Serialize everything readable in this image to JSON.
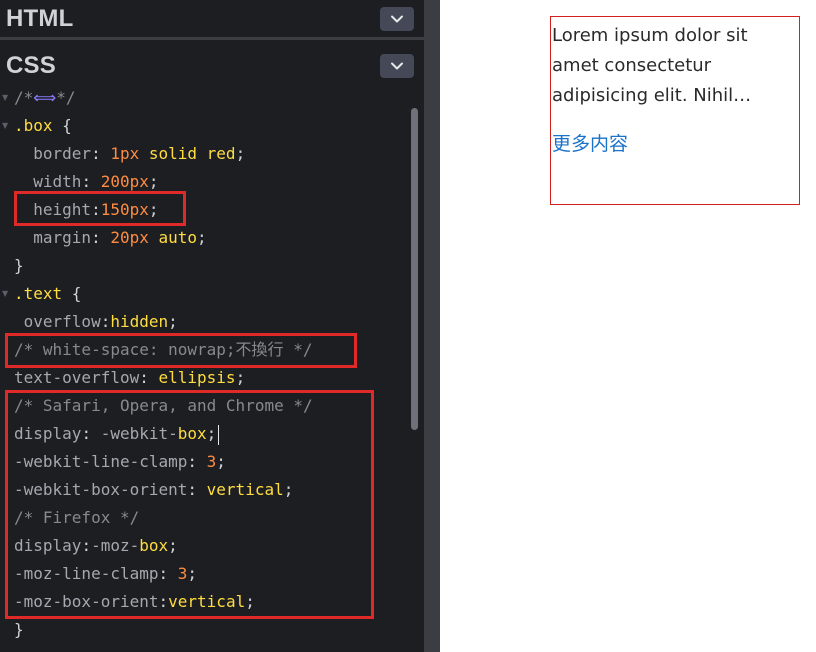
{
  "editor": {
    "html_panel": {
      "title": "HTML",
      "collapse_icon": "chevron-down-icon"
    },
    "css_panel": {
      "title": "CSS",
      "collapse_icon": "chevron-down-icon"
    },
    "code_lines": [
      {
        "tokens": [
          {
            "t": "/*",
            "c": "tok-comment"
          },
          {
            "t": "⟺",
            "c": "tok-arrow"
          },
          {
            "t": "*/",
            "c": "tok-comment"
          }
        ]
      },
      {
        "tokens": [
          {
            "t": ".box",
            "c": "tok-selector"
          },
          {
            "t": " {",
            "c": "tok-punct"
          }
        ]
      },
      {
        "tokens": [
          {
            "t": "  border",
            "c": "tok-prop2"
          },
          {
            "t": ": ",
            "c": "tok-punct"
          },
          {
            "t": "1px",
            "c": "tok-num"
          },
          {
            "t": " solid red",
            "c": "tok-kw"
          },
          {
            "t": ";",
            "c": "tok-punct"
          }
        ]
      },
      {
        "tokens": [
          {
            "t": "  width",
            "c": "tok-prop2"
          },
          {
            "t": ": ",
            "c": "tok-punct"
          },
          {
            "t": "200px",
            "c": "tok-num"
          },
          {
            "t": ";",
            "c": "tok-punct"
          }
        ]
      },
      {
        "tokens": [
          {
            "t": "  height",
            "c": "tok-prop2"
          },
          {
            "t": ":",
            "c": "tok-punct"
          },
          {
            "t": "150px",
            "c": "tok-num"
          },
          {
            "t": ";",
            "c": "tok-punct"
          }
        ]
      },
      {
        "tokens": [
          {
            "t": "  margin",
            "c": "tok-prop2"
          },
          {
            "t": ": ",
            "c": "tok-punct"
          },
          {
            "t": "20px",
            "c": "tok-num"
          },
          {
            "t": " auto",
            "c": "tok-kw"
          },
          {
            "t": ";",
            "c": "tok-punct"
          }
        ]
      },
      {
        "tokens": [
          {
            "t": "}",
            "c": "tok-punct"
          }
        ]
      },
      {
        "tokens": [
          {
            "t": ".text",
            "c": "tok-selector"
          },
          {
            "t": " {",
            "c": "tok-punct"
          }
        ]
      },
      {
        "tokens": [
          {
            "t": " overflow",
            "c": "tok-prop2"
          },
          {
            "t": ":",
            "c": "tok-punct"
          },
          {
            "t": "hidden",
            "c": "tok-kw"
          },
          {
            "t": ";",
            "c": "tok-punct"
          }
        ]
      },
      {
        "tokens": [
          {
            "t": "/* white-space: nowrap;不換行 */",
            "c": "tok-comment"
          }
        ]
      },
      {
        "tokens": [
          {
            "t": "text-overflow",
            "c": "tok-prop2"
          },
          {
            "t": ": ",
            "c": "tok-punct"
          },
          {
            "t": "ellipsis",
            "c": "tok-kw"
          },
          {
            "t": ";",
            "c": "tok-punct"
          }
        ]
      },
      {
        "tokens": [
          {
            "t": "/* Safari, Opera, and Chrome */",
            "c": "tok-comment"
          }
        ]
      },
      {
        "tokens": [
          {
            "t": "display",
            "c": "tok-prop2"
          },
          {
            "t": ": ",
            "c": "tok-punct"
          },
          {
            "t": "-webkit-",
            "c": "tok-prop2"
          },
          {
            "t": "box",
            "c": "tok-kw"
          },
          {
            "t": ";",
            "c": "tok-punct"
          }
        ],
        "caret": true
      },
      {
        "tokens": [
          {
            "t": "-webkit-line-clamp",
            "c": "tok-prop2"
          },
          {
            "t": ": ",
            "c": "tok-punct"
          },
          {
            "t": "3",
            "c": "tok-num"
          },
          {
            "t": ";",
            "c": "tok-punct"
          }
        ]
      },
      {
        "tokens": [
          {
            "t": "-webkit-box-orient",
            "c": "tok-prop2"
          },
          {
            "t": ": ",
            "c": "tok-punct"
          },
          {
            "t": "vertical",
            "c": "tok-kw"
          },
          {
            "t": ";",
            "c": "tok-punct"
          }
        ]
      },
      {
        "tokens": [
          {
            "t": "/* Firefox */",
            "c": "tok-comment"
          }
        ]
      },
      {
        "tokens": [
          {
            "t": "display",
            "c": "tok-prop2"
          },
          {
            "t": ":",
            "c": "tok-punct"
          },
          {
            "t": "-moz-",
            "c": "tok-prop2"
          },
          {
            "t": "box",
            "c": "tok-kw"
          },
          {
            "t": ";",
            "c": "tok-punct"
          }
        ]
      },
      {
        "tokens": [
          {
            "t": "-moz-line-clamp",
            "c": "tok-prop2"
          },
          {
            "t": ": ",
            "c": "tok-punct"
          },
          {
            "t": "3",
            "c": "tok-num"
          },
          {
            "t": ";",
            "c": "tok-punct"
          }
        ]
      },
      {
        "tokens": [
          {
            "t": "-moz-box-orient",
            "c": "tok-prop2"
          },
          {
            "t": ":",
            "c": "tok-punct"
          },
          {
            "t": "vertical",
            "c": "tok-kw"
          },
          {
            "t": ";",
            "c": "tok-punct"
          }
        ]
      },
      {
        "tokens": [
          {
            "t": "}",
            "c": "tok-punct"
          }
        ]
      }
    ],
    "highlight_color": "#e02a2a"
  },
  "preview": {
    "text": "Lorem ipsum dolor sit amet consectetur adipisicing elit. Nihil exercitationem quasi praesentium dolorem voluptatum.",
    "link_label": "更多内容",
    "box_border_color": "#d61f1f",
    "link_color": "#1a73c9"
  }
}
